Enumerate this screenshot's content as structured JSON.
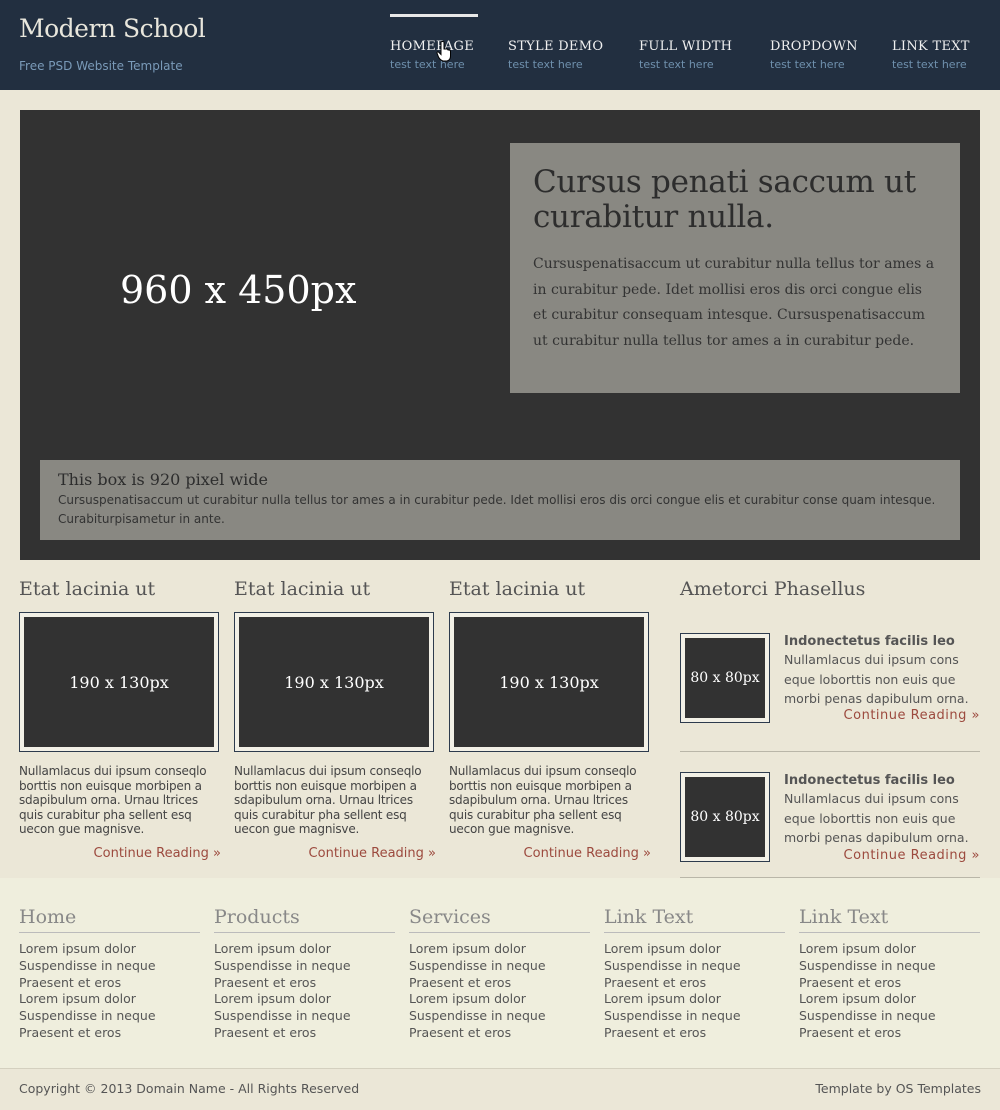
{
  "header": {
    "title": "Modern School",
    "tagline": "Free PSD Website Template",
    "nav": [
      {
        "label": "HOMEPAGE",
        "sub": "test text here"
      },
      {
        "label": "STYLE DEMO",
        "sub": "test text here"
      },
      {
        "label": "FULL WIDTH",
        "sub": "test text here"
      },
      {
        "label": "DROPDOWN",
        "sub": "test text here"
      },
      {
        "label": "LINK TEXT",
        "sub": "test text here"
      }
    ]
  },
  "hero": {
    "placeholder": "960 x 450px",
    "box_title": "Cursus penati saccum ut curabitur nulla.",
    "box_text": "Cursuspenatisaccum ut curabitur nulla tellus tor ames a in curabitur pede. Idet mollisi eros dis orci congue elis et curabitur consequam intesque. Cursuspenatisaccum ut curabitur nulla tellus tor ames a in curabitur pede.",
    "wide_title": "This box is 920 pixel wide",
    "wide_text": "Cursuspenatisaccum ut curabitur nulla tellus tor ames a in curabitur pede. Idet mollisi eros dis orci congue elis et curabitur conse quam intesque. Curabiturpisametur in ante."
  },
  "features": [
    {
      "title": "Etat lacinia ut",
      "image": "190 x 130px",
      "text": "Nullamlacus dui ipsum conseqlo borttis non euisque morbipen a sdapibulum orna. Urnau ltrices quis curabitur pha sellent esq uecon gue magnisve.",
      "more": "Continue Reading »"
    },
    {
      "title": "Etat lacinia ut",
      "image": "190 x 130px",
      "text": "Nullamlacus dui ipsum conseqlo borttis non euisque morbipen a sdapibulum orna. Urnau ltrices quis curabitur pha sellent esq uecon gue magnisve.",
      "more": "Continue Reading »"
    },
    {
      "title": "Etat lacinia ut",
      "image": "190 x 130px",
      "text": "Nullamlacus dui ipsum conseqlo borttis non euisque morbipen a sdapibulum orna. Urnau ltrices quis curabitur pha sellent esq uecon gue magnisve.",
      "more": "Continue Reading »"
    }
  ],
  "sidebar": {
    "title": "Ametorci Phasellus",
    "items": [
      {
        "image": "80 x 80px",
        "heading": "Indonectetus facilis leo",
        "text": "Nullamlacus dui ipsum cons eque loborttis non euis que morbi penas dapibulum orna.",
        "more": "Continue Reading »"
      },
      {
        "image": "80 x 80px",
        "heading": "Indonectetus facilis leo",
        "text": "Nullamlacus dui ipsum cons eque loborttis non euis que morbi penas dapibulum orna.",
        "more": "Continue Reading »"
      }
    ]
  },
  "footer": {
    "columns": [
      {
        "title": "Home",
        "links": [
          "Lorem ipsum dolor",
          "Suspendisse in neque",
          "Praesent et eros",
          "Lorem ipsum dolor",
          "Suspendisse in neque",
          "Praesent et eros"
        ]
      },
      {
        "title": "Products",
        "links": [
          "Lorem ipsum dolor",
          "Suspendisse in neque",
          "Praesent et eros",
          "Lorem ipsum dolor",
          "Suspendisse in neque",
          "Praesent et eros"
        ]
      },
      {
        "title": "Services",
        "links": [
          "Lorem ipsum dolor",
          "Suspendisse in neque",
          "Praesent et eros",
          "Lorem ipsum dolor",
          "Suspendisse in neque",
          "Praesent et eros"
        ]
      },
      {
        "title": "Link Text",
        "links": [
          "Lorem ipsum dolor",
          "Suspendisse in neque",
          "Praesent et eros",
          "Lorem ipsum dolor",
          "Suspendisse in neque",
          "Praesent et eros"
        ]
      },
      {
        "title": "Link Text",
        "links": [
          "Lorem ipsum dolor",
          "Suspendisse in neque",
          "Praesent et eros",
          "Lorem ipsum dolor",
          "Suspendisse in neque",
          "Praesent et eros"
        ]
      }
    ],
    "copyright": "Copyright © 2013 Domain Name - All Rights Reserved",
    "credit": "Template by OS Templates"
  },
  "colors": {
    "header_bg": "#222f40",
    "page_bg": "#ebe7d7",
    "placeholder_bg": "#323232",
    "caption_bg": "#898882",
    "link_accent": "#9c4a3e",
    "footer_bg": "#efeedd"
  }
}
